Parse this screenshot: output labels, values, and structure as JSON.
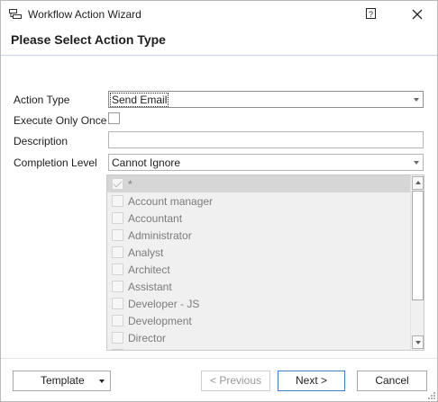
{
  "window": {
    "title": "Workflow Action Wizard"
  },
  "header": {
    "title": "Please Select Action Type"
  },
  "form": {
    "action_type": {
      "label": "Action Type",
      "value": "Send Email"
    },
    "execute_once": {
      "label": "Execute Only Once",
      "checked": false
    },
    "description": {
      "label": "Description",
      "value": ""
    },
    "completion_level": {
      "label": "Completion Level",
      "value": "Cannot Ignore"
    }
  },
  "roles_list": {
    "items": [
      {
        "label": "*",
        "checked": true,
        "selected": true
      },
      {
        "label": "Account manager",
        "checked": false
      },
      {
        "label": "Accountant",
        "checked": false
      },
      {
        "label": "Administrator",
        "checked": false
      },
      {
        "label": "Analyst",
        "checked": false
      },
      {
        "label": "Architect",
        "checked": false
      },
      {
        "label": "Assistant",
        "checked": false
      },
      {
        "label": "Developer - JS",
        "checked": false
      },
      {
        "label": "Development",
        "checked": false
      },
      {
        "label": "Director",
        "checked": false
      }
    ]
  },
  "footer": {
    "template_label": "Template",
    "previous_label": "< Previous",
    "next_label": "Next >",
    "cancel_label": "Cancel"
  }
}
